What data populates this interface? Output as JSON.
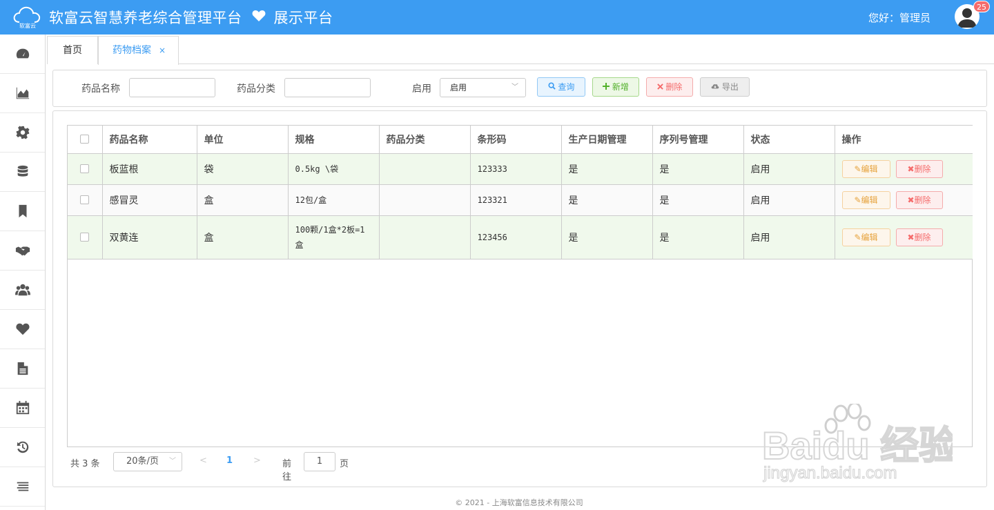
{
  "header": {
    "logo_text": "软富云",
    "app_title": "软富云智慧养老综合管理平台",
    "app_subtitle": "展示平台",
    "greeting": "您好：管理员",
    "notification_count": "25",
    "bg_color": "#3c9cf2"
  },
  "sidebar": {
    "items": [
      {
        "icon": "dashboard-icon"
      },
      {
        "icon": "area-chart-icon"
      },
      {
        "icon": "gear-icon"
      },
      {
        "icon": "database-icon"
      },
      {
        "icon": "bookmark-icon"
      },
      {
        "icon": "handshake-icon"
      },
      {
        "icon": "users-icon"
      },
      {
        "icon": "heart-icon"
      },
      {
        "icon": "document-icon"
      },
      {
        "icon": "calendar-icon"
      },
      {
        "icon": "history-icon"
      },
      {
        "icon": "menu-icon"
      }
    ]
  },
  "tabs": {
    "home": "首页",
    "active": "药物档案",
    "close": "×"
  },
  "search": {
    "name_label": "药品名称",
    "name_value": "",
    "category_label": "药品分类",
    "category_value": "",
    "enabled_label": "启用",
    "enabled_selected": "启用",
    "query_button": "查询",
    "add_button": "新增",
    "delete_button": "删除",
    "export_button": "导出"
  },
  "table": {
    "columns": [
      "药品名称",
      "单位",
      "规格",
      "药品分类",
      "条形码",
      "生产日期管理",
      "序列号管理",
      "状态",
      "操作"
    ],
    "rows": [
      {
        "name": "板蓝根",
        "unit": "袋",
        "spec": "0.5kg \\袋",
        "category": "",
        "barcode": "123333",
        "date_mgmt": "是",
        "serial_mgmt": "是",
        "status": "启用"
      },
      {
        "name": "感冒灵",
        "unit": "盒",
        "spec": "12包/盒",
        "category": "",
        "barcode": "123321",
        "date_mgmt": "是",
        "serial_mgmt": "是",
        "status": "启用"
      },
      {
        "name": "双黄连",
        "unit": "盒",
        "spec": "100颗/1盒*2板=1盒",
        "category": "",
        "barcode": "123456",
        "date_mgmt": "是",
        "serial_mgmt": "是",
        "status": "启用"
      }
    ],
    "edit_label": "编辑",
    "delete_label": "删除"
  },
  "pager": {
    "total": "共 3 条",
    "page_size": "20条/页",
    "prev": "<",
    "current_page": "1",
    "next": ">",
    "goto_label": "前往",
    "goto_value": "1",
    "page_unit": "页"
  },
  "footer": {
    "copyright": "© 2021 - 上海软富信息技术有限公司"
  },
  "watermark": {
    "line1": "Baidu 经验",
    "line2": "jingyan.baidu.com"
  }
}
